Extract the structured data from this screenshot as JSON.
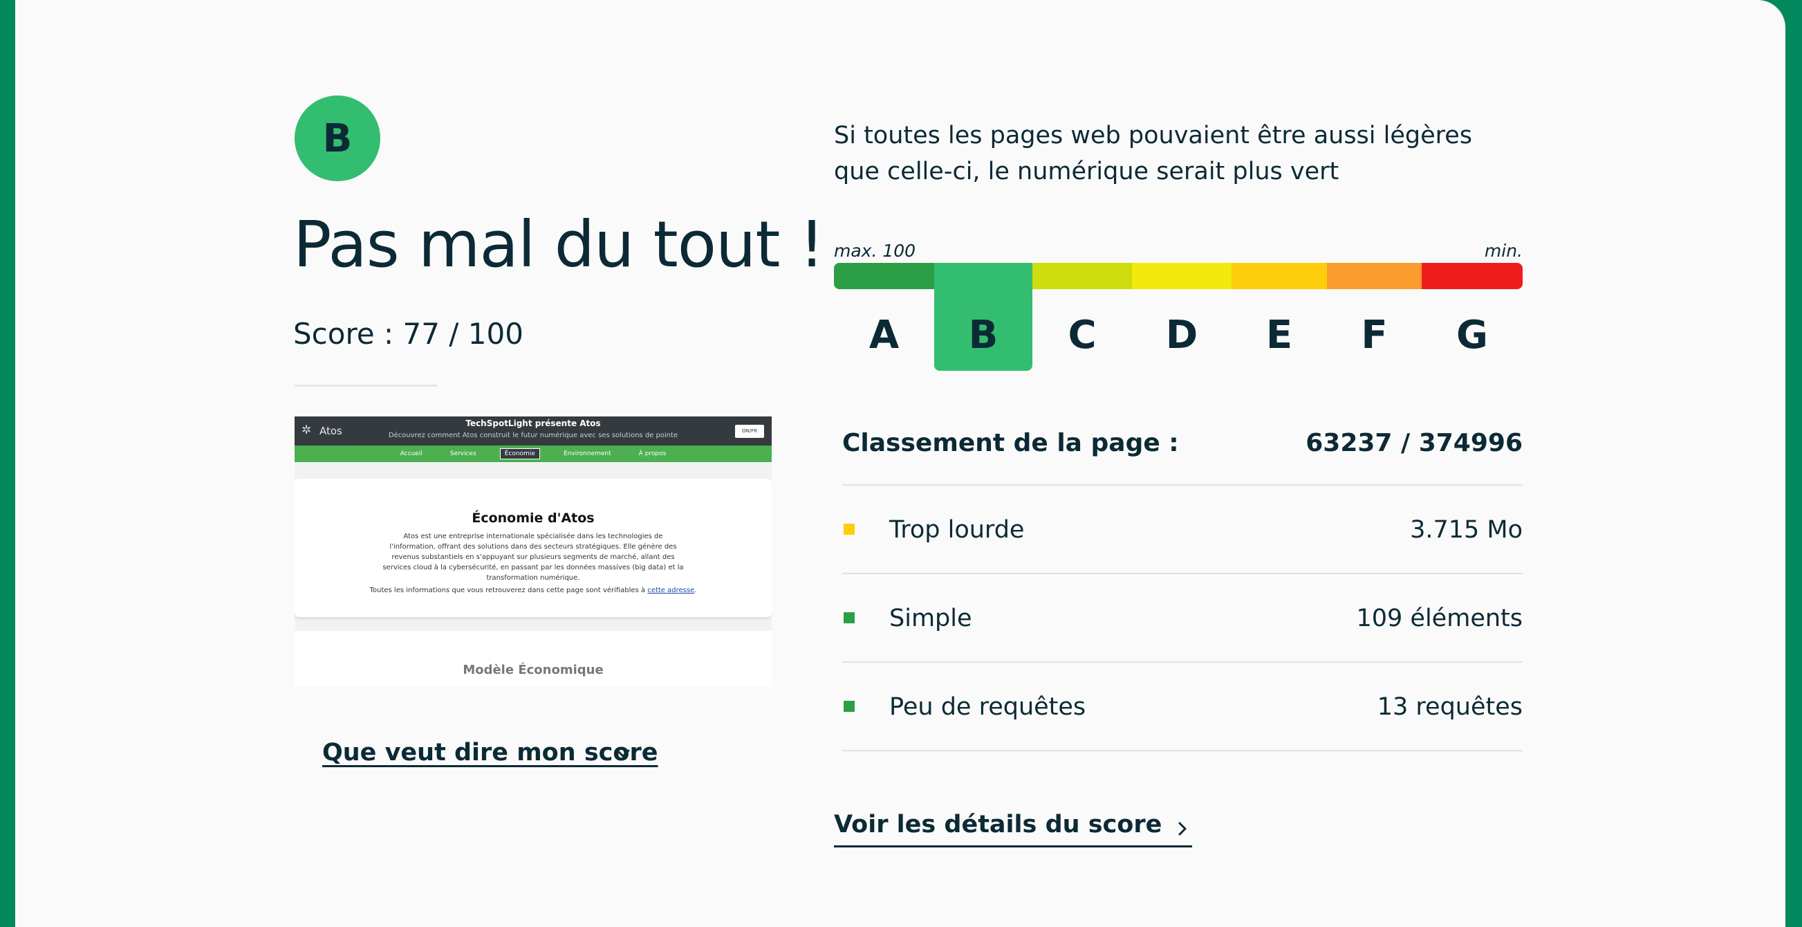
{
  "result": {
    "grade": "B",
    "headline": "Pas mal du tout !",
    "score_text": "Score : 77 / 100",
    "score_value": 77,
    "score_max": 100
  },
  "preview": {
    "site_title": "TechSpotLight présente Atos",
    "site_subtitle": "Découvrez comment Atos construit le futur numérique avec ses solutions de pointe",
    "logo_text": "Atos",
    "button_label": "ON/FR",
    "nav": [
      "Accueil",
      "Services",
      "Économie",
      "Environnement",
      "À propos"
    ],
    "nav_active": "Économie",
    "section_title": "Économie d'Atos",
    "section_text": "Atos est une entreprise internationale spécialisée dans les technologies de l'information, offrant des solutions dans des secteurs stratégiques. Elle génère des revenus substantiels en s'appuyant sur plusieurs segments de marché, allant des services cloud à la cybersécurité, en passant par les données massives (big data) et la transformation numérique.",
    "section_note": "Toutes les informations que vous retrouverez dans cette page sont vérifiables à",
    "section_link": "cette adresse",
    "next_section_title": "Modèle Économique"
  },
  "score_info_link": "Que veut dire mon score",
  "tagline": "Si toutes les pages web pouvaient être aussi légères que celle-ci, le numérique serait plus vert",
  "scale": {
    "max_label": "max. 100",
    "min_label": "min. 0",
    "grades": [
      "A",
      "B",
      "C",
      "D",
      "E",
      "F",
      "G"
    ],
    "colors": [
      "#2c9e46",
      "#33bd70",
      "#cddd0e",
      "#f2ea0d",
      "#fecd0b",
      "#fb9b2e",
      "#ef1d1d"
    ],
    "active_grade": "B"
  },
  "ranking": {
    "label": "Classement de la page :",
    "value": "63237 / 374996"
  },
  "metrics": [
    {
      "label": "Trop lourde",
      "value": "3.715 Mo",
      "color": "#fecd0b"
    },
    {
      "label": "Simple",
      "value": "109 éléments",
      "color": "#2c9e46"
    },
    {
      "label": "Peu de requêtes",
      "value": "13 requêtes",
      "color": "#2c9e46"
    }
  ],
  "details_link": "Voir les détails du score"
}
